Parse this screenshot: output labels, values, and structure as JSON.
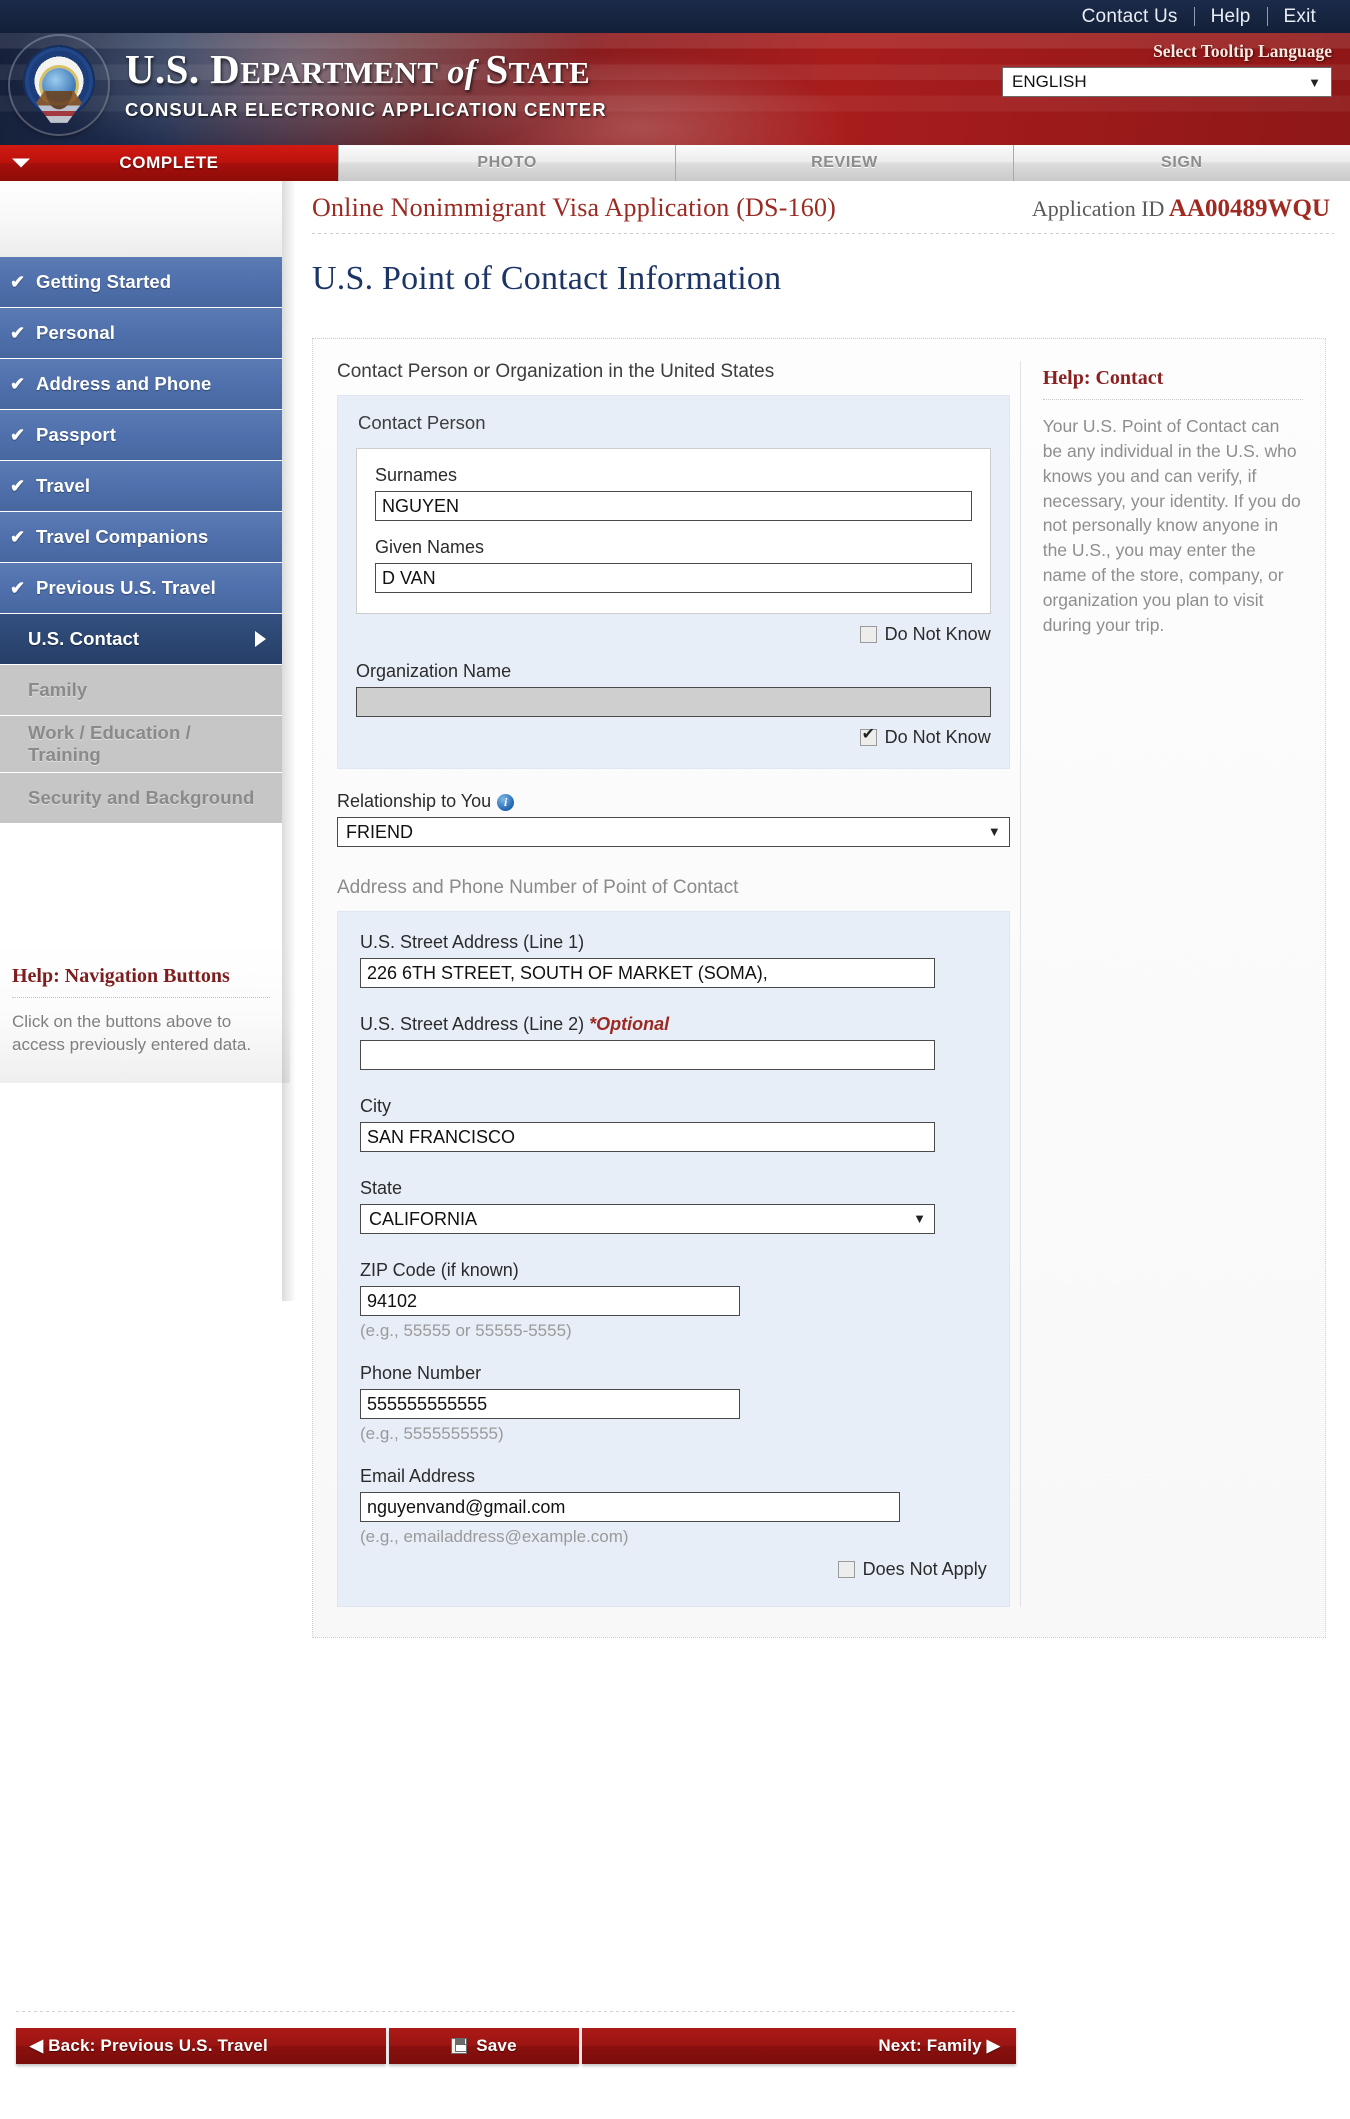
{
  "utility_bar": {
    "links": [
      "Contact Us",
      "Help",
      "Exit"
    ]
  },
  "banner": {
    "brand_line1_a": "U.S. ",
    "brand_line1_b": "D",
    "brand_line1_c": "EPARTMENT",
    "brand_line1_d": " of ",
    "brand_line1_e": "S",
    "brand_line1_f": "TATE",
    "brand_line2": "CONSULAR ELECTRONIC APPLICATION CENTER",
    "tooltip_language_label": "Select Tooltip Language",
    "language_selected": "ENGLISH"
  },
  "tabs": [
    {
      "label": "COMPLETE",
      "state": "active"
    },
    {
      "label": "PHOTO",
      "state": "inactive"
    },
    {
      "label": "REVIEW",
      "state": "inactive"
    },
    {
      "label": "SIGN",
      "state": "inactive"
    }
  ],
  "sidebar": {
    "items": [
      {
        "label": "Getting Started",
        "state": "done"
      },
      {
        "label": "Personal",
        "state": "done"
      },
      {
        "label": "Address and Phone",
        "state": "done"
      },
      {
        "label": "Passport",
        "state": "done"
      },
      {
        "label": "Travel",
        "state": "done"
      },
      {
        "label": "Travel Companions",
        "state": "done"
      },
      {
        "label": "Previous U.S. Travel",
        "state": "done"
      },
      {
        "label": "U.S. Contact",
        "state": "current"
      },
      {
        "label": "Family",
        "state": "future"
      },
      {
        "label": "Work / Education / Training",
        "state": "future"
      },
      {
        "label": "Security and Background",
        "state": "future"
      }
    ],
    "check_glyph": "✔",
    "help": {
      "title": "Help: Navigation Buttons",
      "text": "Click on the buttons above to access previously entered data."
    }
  },
  "header": {
    "form_title": "Online Nonimmigrant Visa Application (DS-160)",
    "application_id_label": "Application ID",
    "application_id_value": "AA00489WQU",
    "page_heading": "U.S. Point of Contact Information"
  },
  "contact_section": {
    "caption": "Contact Person or Organization in the United States",
    "contact_person_legend": "Contact Person",
    "surnames_label": "Surnames",
    "surnames_value": "NGUYEN",
    "given_names_label": "Given Names",
    "given_names_value": "D VAN",
    "person_do_not_know_label": "Do Not Know",
    "person_do_not_know_checked": false,
    "organization_label": "Organization Name",
    "organization_value": "",
    "organization_do_not_know_label": "Do Not Know",
    "organization_do_not_know_checked": true,
    "relationship_label": "Relationship to You",
    "relationship_value": "FRIEND",
    "info_glyph": "i"
  },
  "address_section": {
    "caption": "Address and Phone Number of Point of Contact",
    "street1_label": "U.S. Street Address (Line 1)",
    "street1_value": "226 6TH STREET, SOUTH OF MARKET (SOMA),",
    "street2_label": "U.S. Street Address (Line 2)",
    "street2_optional": "*Optional",
    "street2_value": "",
    "city_label": "City",
    "city_value": "SAN FRANCISCO",
    "state_label": "State",
    "state_value": "CALIFORNIA",
    "zip_label": "ZIP Code (if known)",
    "zip_value": "94102",
    "zip_hint": "(e.g., 55555 or 55555-5555)",
    "phone_label": "Phone Number",
    "phone_value": "555555555555",
    "phone_hint": "(e.g., 5555555555)",
    "email_label": "Email Address",
    "email_value": "nguyenvand@gmail.com",
    "email_hint": "(e.g., emailaddress@example.com)",
    "email_does_not_apply_label": "Does Not Apply",
    "email_does_not_apply_checked": false
  },
  "help_panel": {
    "title": "Help: Contact",
    "text": "Your U.S. Point of Contact can be any individual in the U.S. who knows you and can verify, if necessary, your identity. If you do not personally know anyone in the U.S., you may enter the name of the store, company, or organization you plan to visit during your trip."
  },
  "footer": {
    "back_label": "◀ Back: Previous U.S. Travel",
    "save_label": "Save",
    "next_label": "Next: Family ▶"
  },
  "colors": {
    "brand_red": "#9a1512",
    "brand_navy": "#1c3566",
    "accent_blue": "#4f70ac",
    "help_red": "#8a2020"
  }
}
